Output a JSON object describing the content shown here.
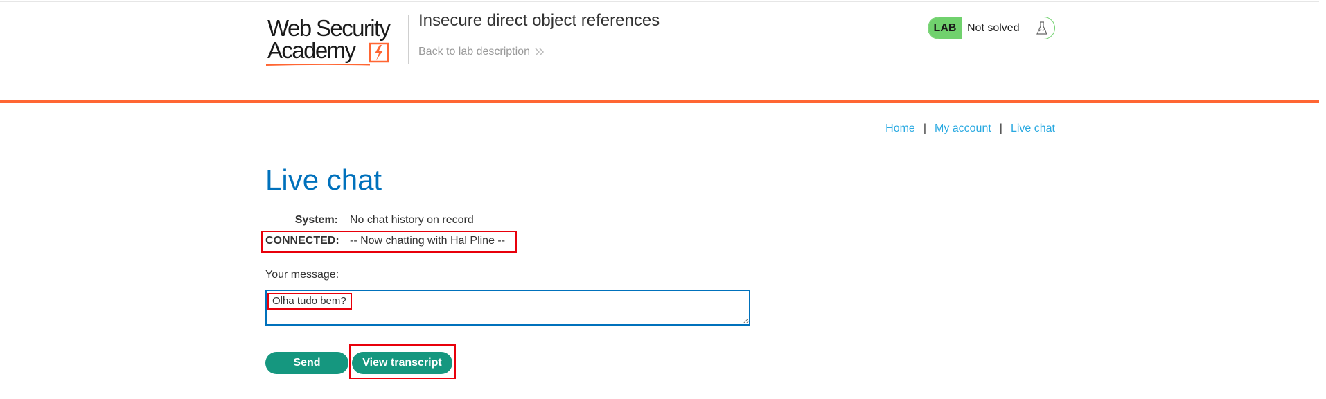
{
  "header": {
    "logo_line1": "Web Security",
    "logo_line2": "Academy",
    "lab_title": "Insecure direct object references",
    "back_link": "Back to lab description",
    "lab_badge": "LAB",
    "lab_status": "Not solved",
    "colors": {
      "accent": "#ff6633",
      "status_green": "#70d16d"
    }
  },
  "nav": {
    "home": "Home",
    "separator": "|",
    "my_account": "My account",
    "live_chat": "Live chat"
  },
  "main": {
    "title": "Live chat",
    "chat": [
      {
        "who": "System:",
        "message": "No chat history on record"
      },
      {
        "who": "CONNECTED:",
        "message": "-- Now chatting with Hal Pline --"
      }
    ],
    "message_label": "Your message:",
    "message_value": "Olha tudo bem?",
    "send_label": "Send",
    "view_transcript_label": "View transcript"
  },
  "icons": {
    "logo_mark": "lightning-bolt-icon",
    "back": "double-chevron-right-icon",
    "flask": "flask-icon"
  }
}
